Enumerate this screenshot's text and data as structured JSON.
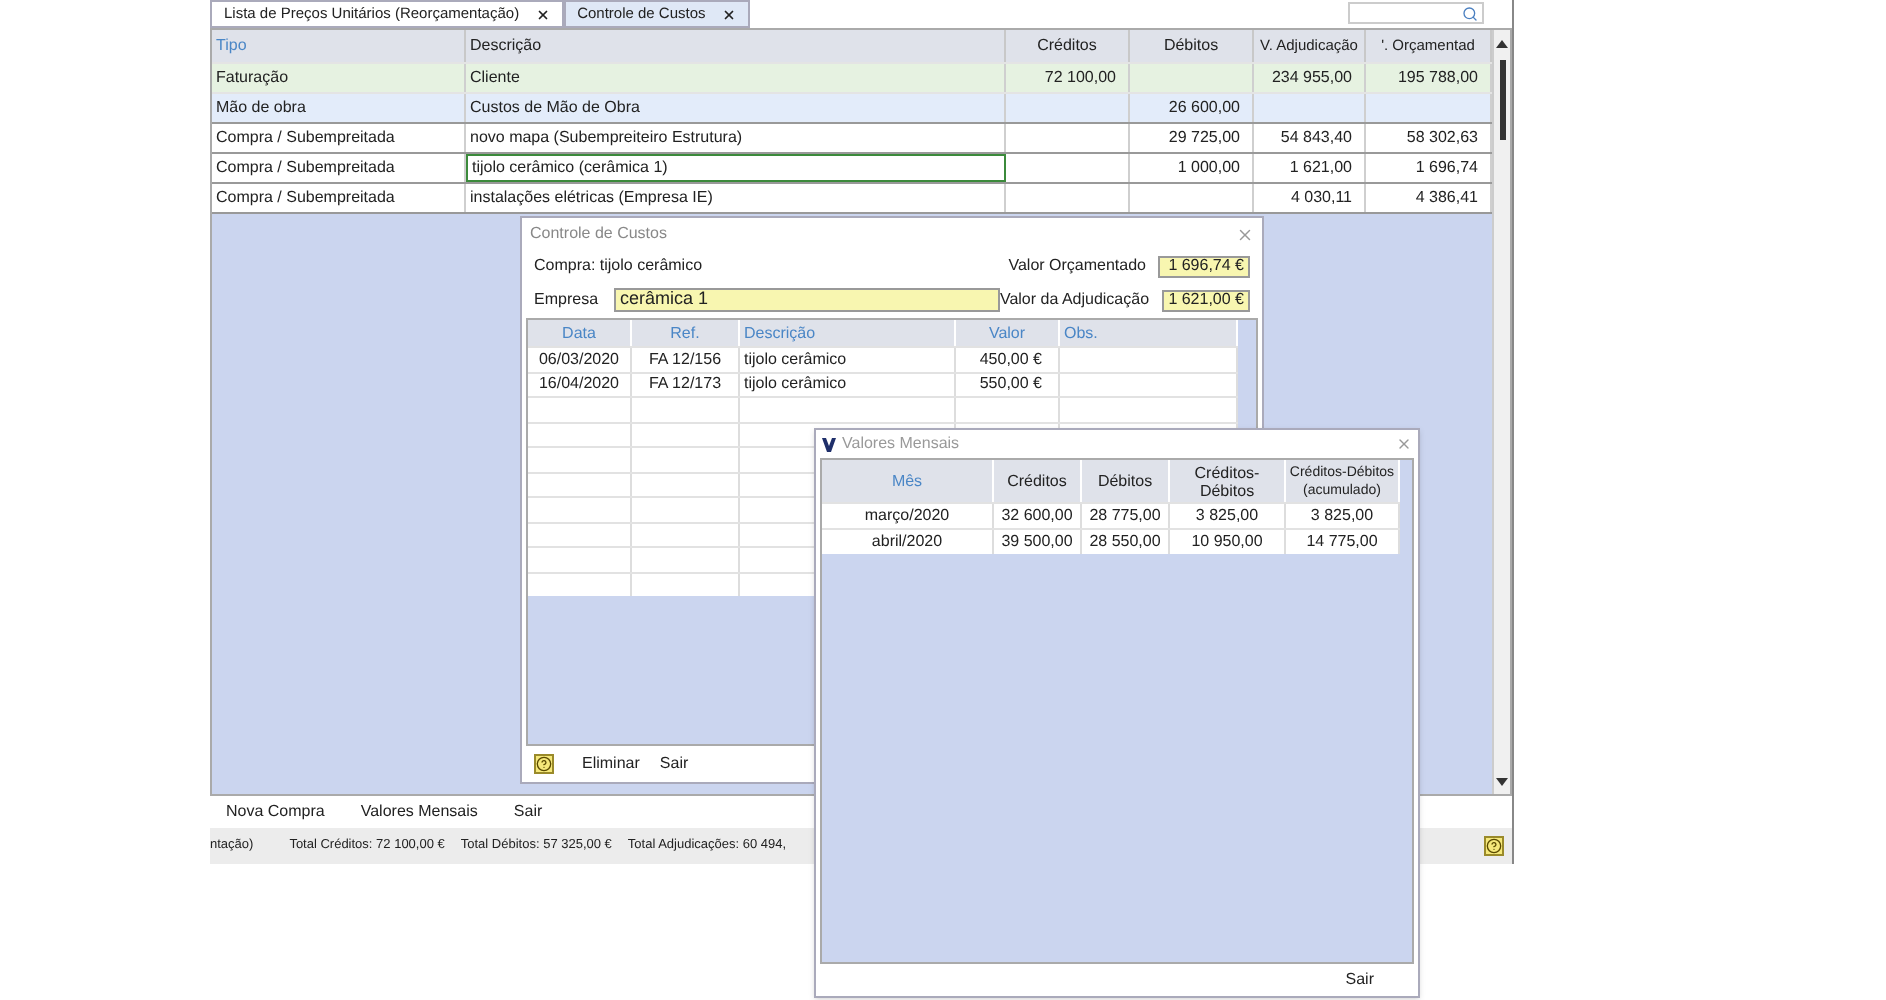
{
  "tabs": [
    {
      "label": "Lista de Preços Unitários (Reorçamentação)",
      "selected": false
    },
    {
      "label": "Controle de Custos",
      "selected": true
    }
  ],
  "main_table": {
    "columns": [
      "Tipo",
      "Descrição",
      "Créditos",
      "Débitos",
      "V. Adjudicação",
      "'. Orçamentad"
    ],
    "rows": [
      {
        "kind": "billing",
        "selected": false,
        "cells": [
          "Faturação",
          "Cliente",
          "72 100,00",
          "",
          "234 955,00",
          "195 788,00"
        ]
      },
      {
        "kind": "labor",
        "selected": false,
        "cells": [
          "Mão de obra",
          "Custos de Mão de Obra",
          "",
          "26 600,00",
          "",
          ""
        ]
      },
      {
        "kind": "purchase",
        "selected": false,
        "cells": [
          "Compra / Subempreitada",
          "novo mapa  (Subempreiteiro Estrutura)",
          "",
          "29 725,00",
          "54 843,40",
          "58 302,63"
        ]
      },
      {
        "kind": "purchase",
        "selected": true,
        "cells": [
          "Compra / Subempreitada",
          "tijolo cerâmico  (cerâmica 1)",
          "",
          "1 000,00",
          "1 621,00",
          "1 696,74"
        ]
      },
      {
        "kind": "purchase",
        "selected": false,
        "cells": [
          "Compra / Subempreitada",
          "instalações elétricas  (Empresa IE)",
          "",
          "",
          "4 030,11",
          "4 386,41"
        ]
      }
    ]
  },
  "toolbar": [
    "Nova Compra",
    "Valores Mensais",
    "Sair"
  ],
  "status_bar": [
    "ntação)",
    "Total Créditos: 72 100,00 €",
    "Total Débitos: 57 325,00 €",
    "Total Adjudicações: 60 494,"
  ],
  "cost_dialog": {
    "title": "Controle de Custos",
    "purchase": "Compra: tijolo cerâmico",
    "budget_label": "Valor Orçamentado",
    "budget_value": "1 696,74 €",
    "company_label": "Empresa",
    "company_value": "cerâmica 1",
    "award_label": "Valor da Adjudicação",
    "award_value": "1 621,00 €",
    "columns": [
      "Data",
      "Ref.",
      "Descrição",
      "Valor",
      "Obs."
    ],
    "rows": [
      [
        "06/03/2020",
        "FA 12/156",
        "tijolo cerâmico",
        "450,00 €",
        ""
      ],
      [
        "16/04/2020",
        "FA 12/173",
        "tijolo cerâmico",
        "550,00 €",
        ""
      ]
    ],
    "buttons": [
      "Eliminar",
      "Sair"
    ]
  },
  "monthly_dialog": {
    "title": "Valores Mensais",
    "columns": [
      "Mês",
      "Créditos",
      "Débitos",
      "Créditos-Débitos",
      "Créditos-Débitos (acumulado)"
    ],
    "rows": [
      [
        "março/2020",
        "32 600,00",
        "28 775,00",
        "3 825,00",
        "3 825,00"
      ],
      [
        "abril/2020",
        "39 500,00",
        "28 550,00",
        "10 950,00",
        "14 775,00"
      ]
    ],
    "buttons": [
      "Sair"
    ]
  }
}
